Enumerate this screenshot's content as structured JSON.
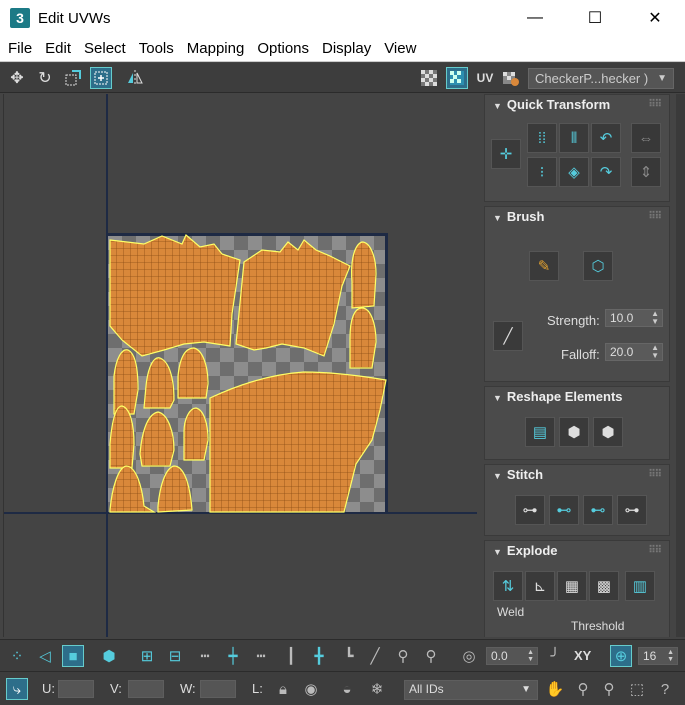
{
  "window": {
    "title": "Edit UVWs",
    "app_icon": "3",
    "minimize_label": "—",
    "maximize_label": "☐",
    "close_label": "✕"
  },
  "menu": [
    "File",
    "Edit",
    "Select",
    "Tools",
    "Mapping",
    "Options",
    "Display",
    "View"
  ],
  "toolbar_top": {
    "uv_label": "UV",
    "texture_dropdown": "CheckerP...hecker )"
  },
  "panel": {
    "quick_transform": {
      "title": "Quick Transform"
    },
    "brush": {
      "title": "Brush",
      "strength_label": "Strength:",
      "strength_value": "10.0",
      "falloff_label": "Falloff:",
      "falloff_value": "20.0"
    },
    "reshape": {
      "title": "Reshape Elements"
    },
    "stitch": {
      "title": "Stitch"
    },
    "explode": {
      "title": "Explode",
      "weld_label": "Weld",
      "threshold_label": "Threshold"
    }
  },
  "bottom1": {
    "angle_value": "0.0",
    "xy_label": "XY",
    "grid_value": "16"
  },
  "bottom2": {
    "u_label": "U:",
    "v_label": "V:",
    "w_label": "W:",
    "l_label": "L:",
    "ids_dropdown": "All IDs"
  },
  "colors": {
    "accent": "#4fc3d9",
    "uv_fill": "#d9883a",
    "uv_edge": "#ffff66",
    "grid_line": "#1e2a44"
  }
}
